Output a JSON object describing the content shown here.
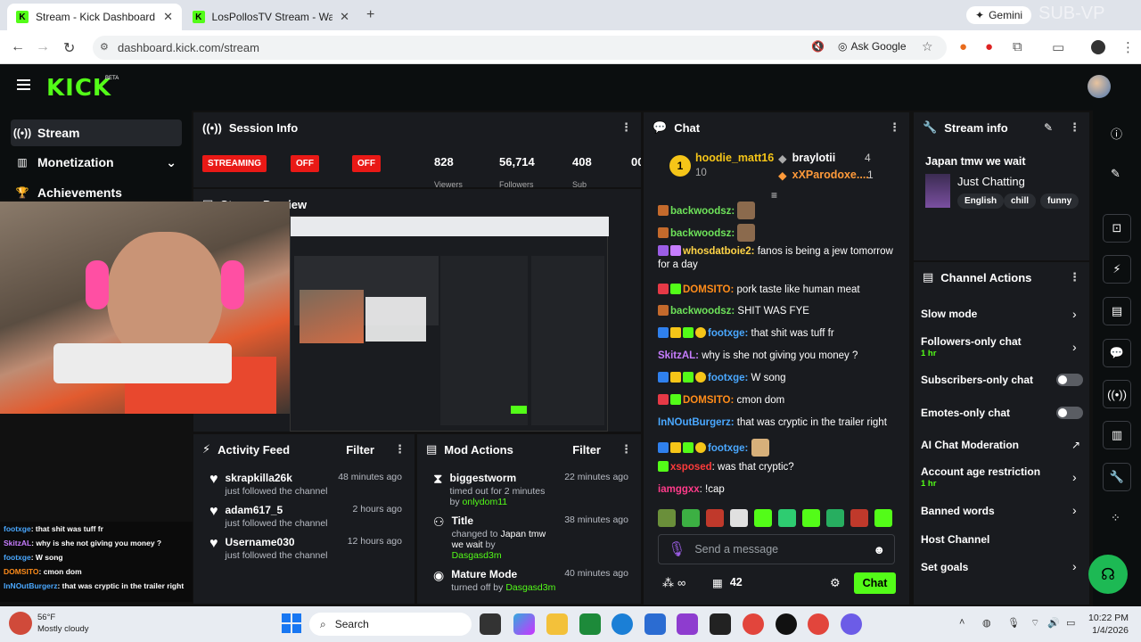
{
  "browser": {
    "tabs": [
      {
        "title": "Stream - Kick Dashboard"
      },
      {
        "title": "LosPollosTV Stream - Watch Li..."
      }
    ],
    "url": "dashboard.kick.com/stream",
    "ask_google": "Ask Google",
    "gemini": "Gemini",
    "watermark": "SUB-VP"
  },
  "app": {
    "logo": "KICK",
    "beta": "BETA"
  },
  "sidebar": {
    "items": [
      {
        "label": "Stream",
        "icon": "broadcast-icon"
      },
      {
        "label": "Monetization",
        "icon": "chart-icon"
      },
      {
        "label": "Achievements",
        "icon": "trophy-icon"
      }
    ]
  },
  "session": {
    "title": "Session Info",
    "status": [
      "STREAMING",
      "OFF",
      "OFF"
    ],
    "stats": [
      "828",
      "56,714",
      "408",
      "00"
    ],
    "stat_labels": [
      "Viewers",
      "Followers",
      "Sub"
    ]
  },
  "preview": {
    "title": "Stream Preview"
  },
  "activity": {
    "title": "Activity Feed",
    "filter": "Filter",
    "items": [
      {
        "name": "skrapkilla26k",
        "sub": "just followed the channel",
        "time": "48 minutes ago"
      },
      {
        "name": "adam617_5",
        "sub": "just followed the channel",
        "time": "2 hours ago"
      },
      {
        "name": "Username030",
        "sub": "just followed the channel",
        "time": "12 hours ago"
      }
    ]
  },
  "mod": {
    "title": "Mod Actions",
    "filter": "Filter",
    "items": [
      {
        "name": "biggestworm",
        "sub": "timed out for 2 minutes by ",
        "by": "onlydom11",
        "time": "22 minutes ago"
      },
      {
        "name": "Title",
        "sub": "changed to ",
        "highlight": "Japan tmw we wait",
        "sub2": " by",
        "by": "Dasgasd3m",
        "time": "38 minutes ago"
      },
      {
        "name": "Mature Mode",
        "sub": "turned off by ",
        "by": "Dasgasd3m",
        "time": "40 minutes ago"
      }
    ]
  },
  "chat": {
    "title": "Chat",
    "top_gifters": [
      {
        "rank": "1",
        "name": "hoodie_matt16",
        "count": "10"
      },
      {
        "name": "braylotii",
        "count": "4"
      },
      {
        "name": "xXParodoxe....",
        "count": "1"
      }
    ],
    "messages": [
      {
        "user": "backwoodsz:",
        "text": "",
        "color": "#6ee35a"
      },
      {
        "user": "backwoodsz:",
        "text": "",
        "color": "#6ee35a"
      },
      {
        "user": "whosdatboie2:",
        "text": " fanos is being a jew tomorrow for a day",
        "color": "#ffd447"
      },
      {
        "user": "DOMSITO:",
        "text": " pork taste like human meat",
        "color": "#ff8c1a"
      },
      {
        "user": "backwoodsz:",
        "text": " SHIT WAS FYE",
        "color": "#6ee35a"
      },
      {
        "user": "footxge:",
        "text": " that shit was tuff fr",
        "color": "#4aa8ff"
      },
      {
        "user": "SkitzAL:",
        "text": " why is she not giving you money ?",
        "color": "#c77dff"
      },
      {
        "user": "footxge:",
        "text": " W song",
        "color": "#4aa8ff"
      },
      {
        "user": "DOMSITO:",
        "text": " cmon dom",
        "color": "#ff8c1a"
      },
      {
        "user": "InNOutBurgerz:",
        "text": " that was cryptic in the trailer right",
        "color": "#4aa8ff"
      },
      {
        "user": "footxge:",
        "text": "",
        "color": "#4aa8ff"
      },
      {
        "user": "xsposed",
        "text": ": was that cryptic?",
        "color": "#ff3b3b"
      },
      {
        "user": "iamggxx",
        "text": ": !cap",
        "color": "#ff3b8a"
      }
    ],
    "placeholder": "Send a message",
    "viewers": "42",
    "send": "Chat"
  },
  "stream_info": {
    "title": "Stream info",
    "stream_title": "Japan tmw we wait",
    "category": "Just Chatting",
    "tags": [
      "English",
      "chill",
      "funny"
    ]
  },
  "channel_actions": {
    "title": "Channel Actions",
    "items": [
      {
        "label": "Slow mode"
      },
      {
        "label": "Followers-only chat",
        "hint": "1 hr"
      },
      {
        "label": "Subscribers-only chat"
      },
      {
        "label": "Emotes-only chat"
      },
      {
        "label": "AI Chat Moderation"
      },
      {
        "label": "Account age restriction",
        "hint": "1 hr"
      },
      {
        "label": "Banned words"
      },
      {
        "label": "Host Channel"
      },
      {
        "label": "Set goals"
      }
    ]
  },
  "overlay_chat": [
    {
      "user": "footxge",
      "text": ": that shit was tuff fr"
    },
    {
      "user": "SkitzAL",
      "text": ": why is she not giving you money ?"
    },
    {
      "user": "footxge",
      "text": ": W song"
    },
    {
      "user": "DOMSITO",
      "text": ": cmon dom"
    },
    {
      "user": "InNOutBurgerz",
      "text": ": that was cryptic in the trailer right"
    }
  ],
  "weather": {
    "temp": "56°F",
    "desc": "Mostly cloudy"
  },
  "taskbar": {
    "search": "Search",
    "time": "10:22 PM",
    "date": "1/4/2026"
  }
}
